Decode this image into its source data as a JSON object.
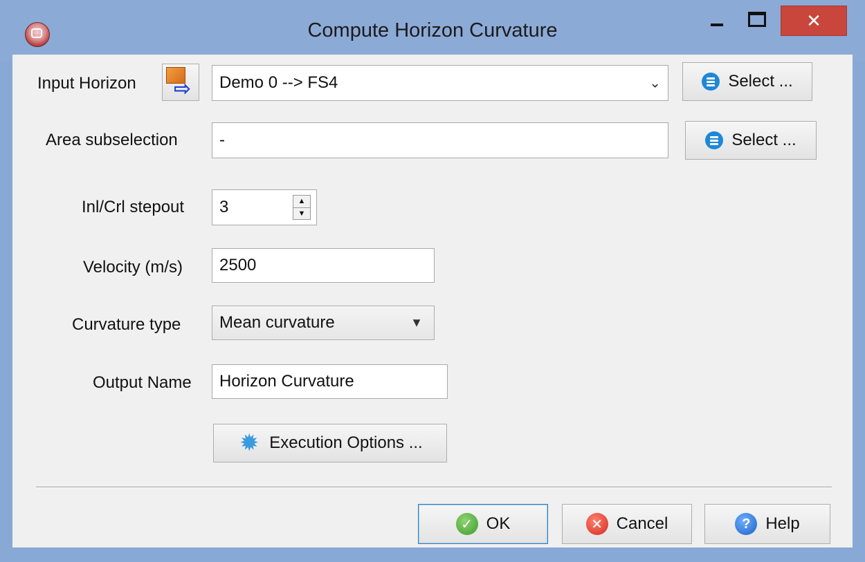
{
  "window": {
    "title": "Compute Horizon Curvature"
  },
  "titlebar": {
    "close_glyph": "✕"
  },
  "form": {
    "input_horizon": {
      "label": "Input Horizon",
      "value": "Demo 0 --> FS4",
      "select_label": "Select ..."
    },
    "area_subselection": {
      "label": "Area subselection",
      "value": "-",
      "select_label": "Select ..."
    },
    "stepout": {
      "label": "Inl/Crl stepout",
      "value": "3"
    },
    "velocity": {
      "label": "Velocity (m/s)",
      "value": "2500"
    },
    "curvature_type": {
      "label": "Curvature type",
      "value": "Mean curvature"
    },
    "output_name": {
      "label": "Output Name",
      "value": "Horizon Curvature"
    },
    "execution_options_label": "Execution Options ..."
  },
  "buttons": {
    "ok": "OK",
    "cancel": "Cancel",
    "help": "Help"
  },
  "icons": {
    "app": "app-logo-icon",
    "horizon": "horizon-input-icon",
    "select": "list-icon",
    "gear": "gear-icon",
    "ok": "check-icon",
    "cancel": "cancel-icon",
    "help": "help-icon"
  },
  "colors": {
    "titlebar": "#8caad6",
    "close": "#c9463d",
    "accent_blue": "#1e88d8"
  }
}
